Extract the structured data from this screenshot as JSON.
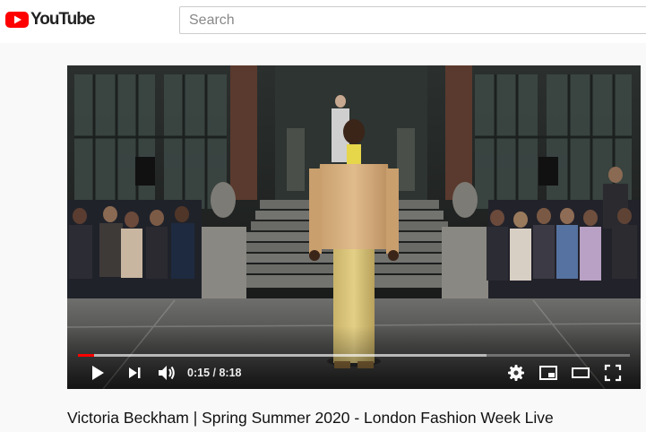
{
  "header": {
    "logo_text": "YouTube",
    "search_placeholder": "Search"
  },
  "player": {
    "current_time": "0:15",
    "time_separator": " / ",
    "duration": "8:18",
    "played_fraction": 0.03,
    "buffered_fraction": 0.74,
    "accent_color": "#ff0000"
  },
  "video": {
    "title": "Victoria Beckham | Spring Summer 2020 - London Fashion Week Live"
  }
}
